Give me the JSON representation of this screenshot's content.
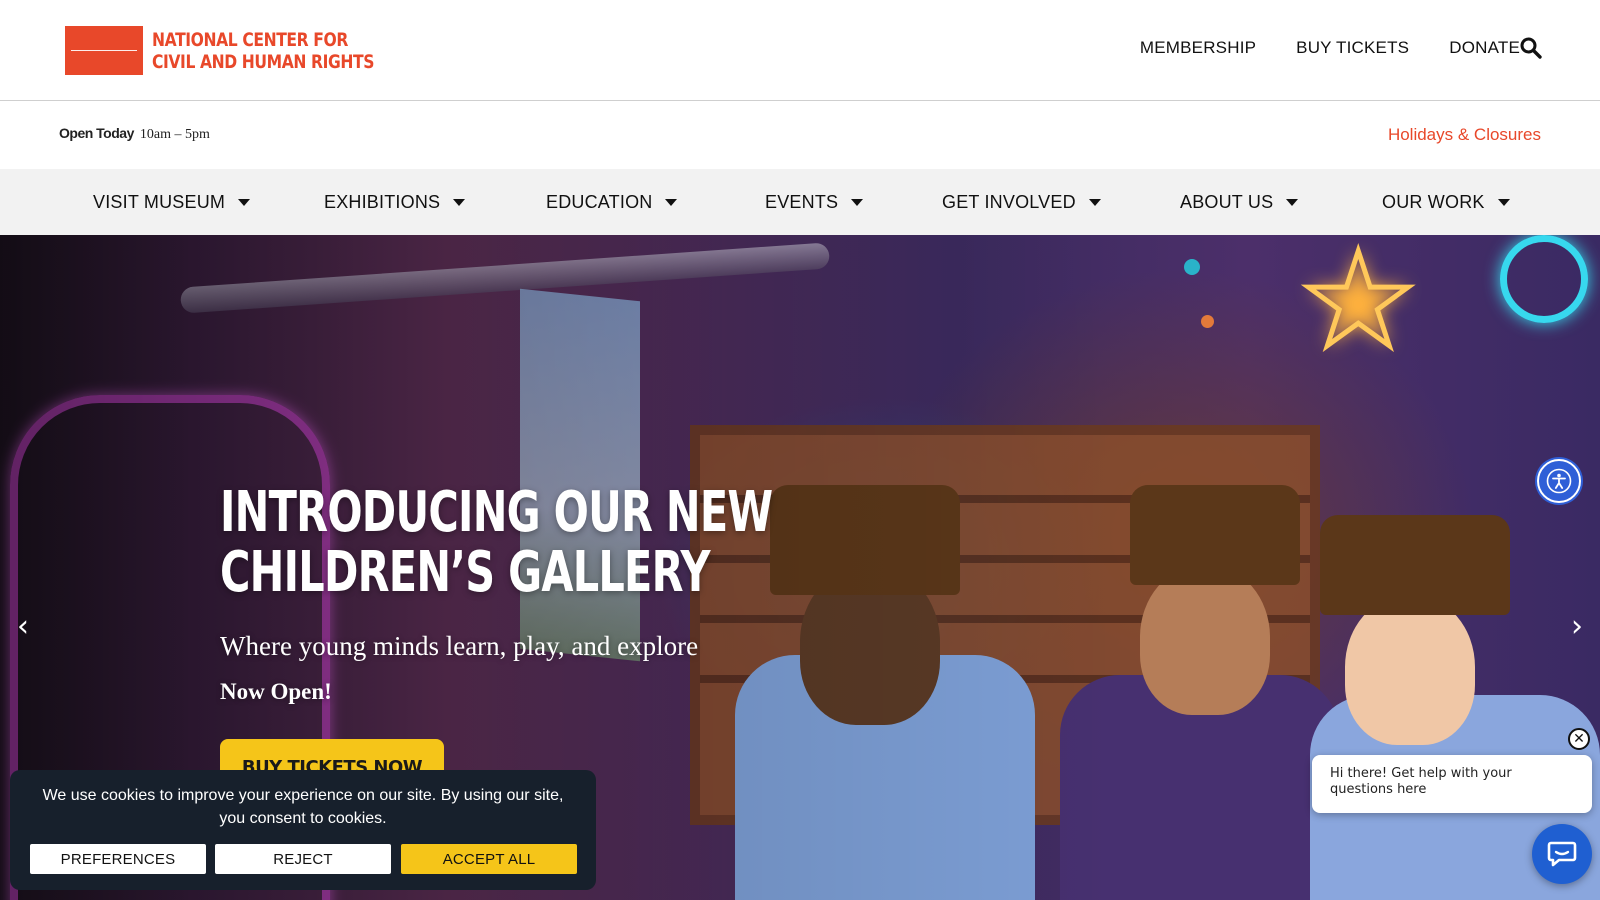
{
  "header": {
    "logo_line1": "NATIONAL CENTER FOR",
    "logo_line2": "CIVIL AND HUMAN RIGHTS",
    "utility_nav": [
      "MEMBERSHIP",
      "BUY TICKETS",
      "DONATE"
    ],
    "search_icon": "search-icon"
  },
  "hours": {
    "label": "Open Today",
    "time": "10am – 5pm",
    "holidays_link": "Holidays & Closures"
  },
  "main_nav": [
    "VISIT MUSEUM",
    "EXHIBITIONS",
    "EDUCATION",
    "EVENTS",
    "GET INVOLVED",
    "ABOUT US",
    "OUR WORK"
  ],
  "hero": {
    "title_line1": "INTRODUCING OUR NEW",
    "title_line2": "CHILDREN’S GALLERY",
    "subtitle": "Where young minds learn, play, and explore",
    "status": "Now Open!",
    "cta": "BUY TICKETS NOW",
    "prev_icon": "‹",
    "next_icon": "›"
  },
  "cookie": {
    "message": "We use cookies to improve your experience on our site. By using our site, you consent to cookies.",
    "preferences": "PREFERENCES",
    "reject": "REJECT",
    "accept": "ACCEPT ALL"
  },
  "chat": {
    "greeting": "Hi there! Get help with your questions here",
    "close": "✕"
  },
  "colors": {
    "brand_orange": "#e8482a",
    "cta_yellow": "#f5c519",
    "nav_bg": "#f2f2f2",
    "cookie_bg": "#17202c",
    "chat_blue": "#1f5fd1",
    "a11y_blue": "#2f5fd7"
  }
}
